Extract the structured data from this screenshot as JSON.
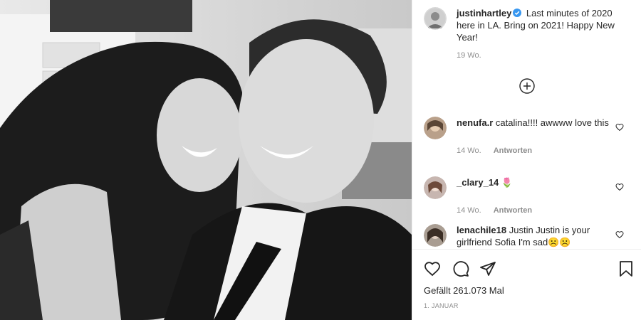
{
  "post": {
    "username": "justinhartley",
    "caption": "Last minutes of 2020 here in LA. Bring on 2021! Happy New Year!",
    "caption_age": "19 Wo.",
    "likes_text": "Gefällt 261.073 Mal",
    "date": "1. JANUAR"
  },
  "comments": [
    {
      "user": "nenufa.r",
      "text": "catalina!!!! awwww love this",
      "age": "14 Wo.",
      "reply": "Antworten"
    },
    {
      "user": "_clary_14",
      "text": "🌷",
      "age": "14 Wo.",
      "reply": "Antworten"
    },
    {
      "user": "lenachile18",
      "text": "Justin Justin is your girlfriend Sofia I'm sad☹️☹️",
      "age": "",
      "reply": ""
    }
  ],
  "icons": {
    "verified": "verified-badge-icon",
    "load_more": "plus-circle-icon",
    "like": "heart-icon",
    "comment": "comment-icon",
    "share": "paper-plane-icon",
    "save": "bookmark-icon"
  },
  "colors": {
    "verified_blue": "#3897f0",
    "text": "#262626",
    "muted": "#8e8e8e"
  }
}
